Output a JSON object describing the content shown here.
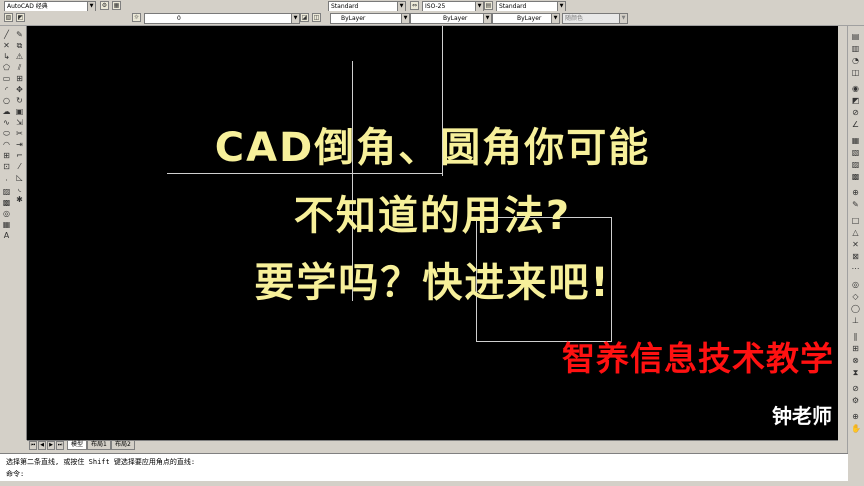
{
  "toolbar1": {
    "workspace": "AutoCAD 经典",
    "text_style": "Standard",
    "dim_style": "ISO-25",
    "table_style": "Standard"
  },
  "toolbar2": {
    "layer": "0",
    "color": "ByLayer",
    "linetype": "ByLayer",
    "lineweight": "ByLayer",
    "plot_style": "随颜色"
  },
  "canvas": {
    "headline_1": "CAD倒角、圆角你可能",
    "headline_2": "不知道的用法?",
    "headline_3": "要学吗？快进来吧!",
    "brand": "智养信息技术教学",
    "teacher": "钟老师"
  },
  "tabs": [
    "模型",
    "布局1",
    "布局2"
  ],
  "command": {
    "history": "选择第二条直线, 或按住 Shift 键选择要应用角点的直线:",
    "prompt": "命令:"
  },
  "colors": {
    "canvas_bg": "#000000",
    "headline": "#f7f09a",
    "brand": "#ff1111",
    "teacher": "#ffffff"
  }
}
